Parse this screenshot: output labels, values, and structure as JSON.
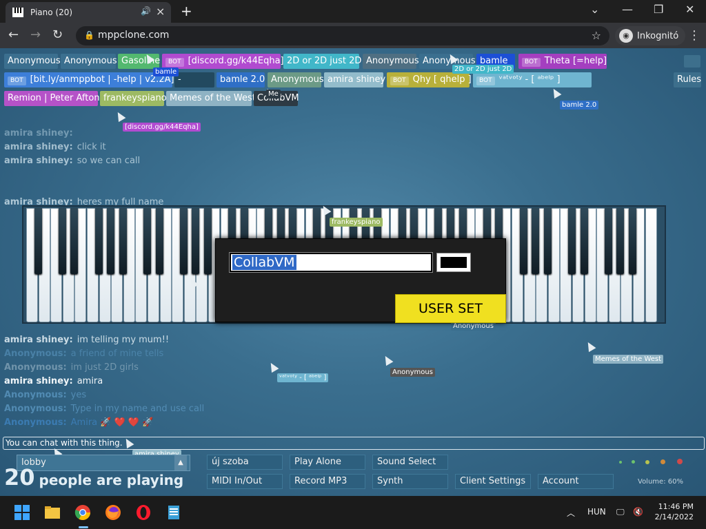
{
  "browser": {
    "tab_title": "Piano (20)",
    "url": "mppclone.com",
    "incognito_label": "Inkognitó"
  },
  "user_tags": [
    {
      "label": "Anonymous",
      "color": "#3b6f8f",
      "bot": false
    },
    {
      "label": "Anonymous",
      "color": "#3b6f8f",
      "bot": false
    },
    {
      "label": "Gasoline",
      "color": "#53b86f",
      "bot": false
    },
    {
      "label": "[discord.gg/k44Eqha]",
      "color": "#b14bd0",
      "bot": true
    },
    {
      "label": "2D or 2D just 2D",
      "color": "#41b7c9",
      "bot": false
    },
    {
      "label": "Anonymous",
      "color": "#4f6f82",
      "bot": false
    },
    {
      "label": "Anonymous",
      "color": "#3b6f8f",
      "bot": false
    },
    {
      "label": "bamle",
      "color": "#1c4fd6",
      "bot": false
    },
    {
      "label": "Theta [=help]",
      "color": "#a43fc0",
      "bot": true
    },
    {
      "label": "[bit.ly/anmppbot | -help | v2.2A]",
      "color": "#3d7fd9",
      "bot": true
    },
    {
      "label": "-",
      "color": "#22495f",
      "bot": false
    },
    {
      "label": "bamle 2.0",
      "color": "#2f6fc6",
      "bot": false
    },
    {
      "label": "Anonymous",
      "color": "#6c9a86",
      "bot": false
    },
    {
      "label": "amira shiney",
      "color": "#93bccb",
      "bot": false
    },
    {
      "label": "Qhy [ qhelp ]",
      "color": "#b8b03a",
      "bot": true
    },
    {
      "label": "ᵛᵃᵗᵛᵒᵗʸ - [ ᵃᵇᵉˡᵖ ]",
      "color": "#6fb5d0",
      "bot": true
    },
    {
      "label": "Rules",
      "color": "#3d6f8c",
      "bot": false
    },
    {
      "label": "Remion | Peter Afton",
      "color": "#b552c8",
      "bot": false
    },
    {
      "label": "frankeyspiano",
      "color": "#9dba63",
      "bot": false
    },
    {
      "label": "Memes of the West",
      "color": "#8fb3c4",
      "bot": false
    },
    {
      "label": "CollabVM",
      "color": "#2d3a44",
      "bot": false
    }
  ],
  "cursor_labels": [
    {
      "label": "bamle",
      "color": "#1c4fd6"
    },
    {
      "label": "2D or 2D just 2D",
      "color": "#41b7c9"
    },
    {
      "label": "Me",
      "color": "#2d3a44"
    },
    {
      "label": "bamle 2.0",
      "color": "#2f6fc6"
    },
    {
      "label": "[discord.gg/k44Eqha]",
      "color": "#b14bd0"
    },
    {
      "label": "frankeyspiano",
      "color": "#9dba63"
    },
    {
      "label": "Anonymous",
      "color": "#3b6f8f"
    },
    {
      "label": "Memes of the West",
      "color": "#8fb3c4"
    },
    {
      "label": "Anonymous",
      "color": "#555555"
    },
    {
      "label": "ᵛᵃᵗᵛᵒᵗʸ - [ ᵃᵇᵉˡᵖ ]",
      "color": "#6fb5d0"
    },
    {
      "label": "amira shiney",
      "color": "#93bccb"
    },
    {
      "label": "Anonymous",
      "color": "#3b6f8f"
    }
  ],
  "chat": [
    {
      "name": "amira shiney:",
      "text": "",
      "color": "#a9c7d8",
      "opacity": 0.55
    },
    {
      "name": "amira shiney:",
      "text": "click it",
      "color": "#c6dbe6",
      "opacity": 0.75
    },
    {
      "name": "amira shiney:",
      "text": "so we can call",
      "color": "#c6dbe6",
      "opacity": 0.8
    },
    {
      "name": "",
      "text": "",
      "color": "#a9c7d8",
      "opacity": 0.3
    },
    {
      "name": "",
      "text": "",
      "color": "#a9c7d8",
      "opacity": 0.3
    },
    {
      "name": "amira shiney:",
      "text": "heres my full name",
      "color": "#c6dbe6",
      "opacity": 0.85
    },
    {
      "name": "amira shiney:",
      "text": "im telling my mum!!",
      "color": "#dce9f0",
      "opacity": 0.9
    },
    {
      "name": "Anonymous:",
      "text": "a friend of mine tells",
      "color": "#5a96c0",
      "opacity": 0.6
    },
    {
      "name": "Anonymous:",
      "text": "im just 2D girls",
      "color": "#9bb7c8",
      "opacity": 0.6
    },
    {
      "name": "amira shiney:",
      "text": "amira",
      "color": "#f0f5f8",
      "opacity": 1
    },
    {
      "name": "Anonymous:",
      "text": "yes",
      "color": "#5a96c0",
      "opacity": 0.8
    },
    {
      "name": "Anonymous:",
      "text": "Type in my name and use call",
      "color": "#5a96c0",
      "opacity": 0.8
    },
    {
      "name": "Anonymous:",
      "text": "Amira 🚀 ❤️ ❤️ 🚀",
      "color": "#3d7fb8",
      "opacity": 0.9
    }
  ],
  "modal": {
    "name_value": "CollabVM",
    "name_color": "#000000",
    "submit_label": "USER SET"
  },
  "chat_input": {
    "placeholder": "You can chat with this thing."
  },
  "bottom": {
    "room": "lobby",
    "count": "20",
    "count_text": "people are playing",
    "buttons": {
      "new_room": "új szoba",
      "play_alone": "Play Alone",
      "sound_select": "Sound Select",
      "midi": "MIDI In/Out",
      "record": "Record MP3",
      "synth": "Synth",
      "client_settings": "Client Settings",
      "account": "Account"
    },
    "volume": "Volume: 60%"
  },
  "taskbar": {
    "language": "HUN",
    "time": "11:46 PM",
    "date": "2/14/2022"
  }
}
